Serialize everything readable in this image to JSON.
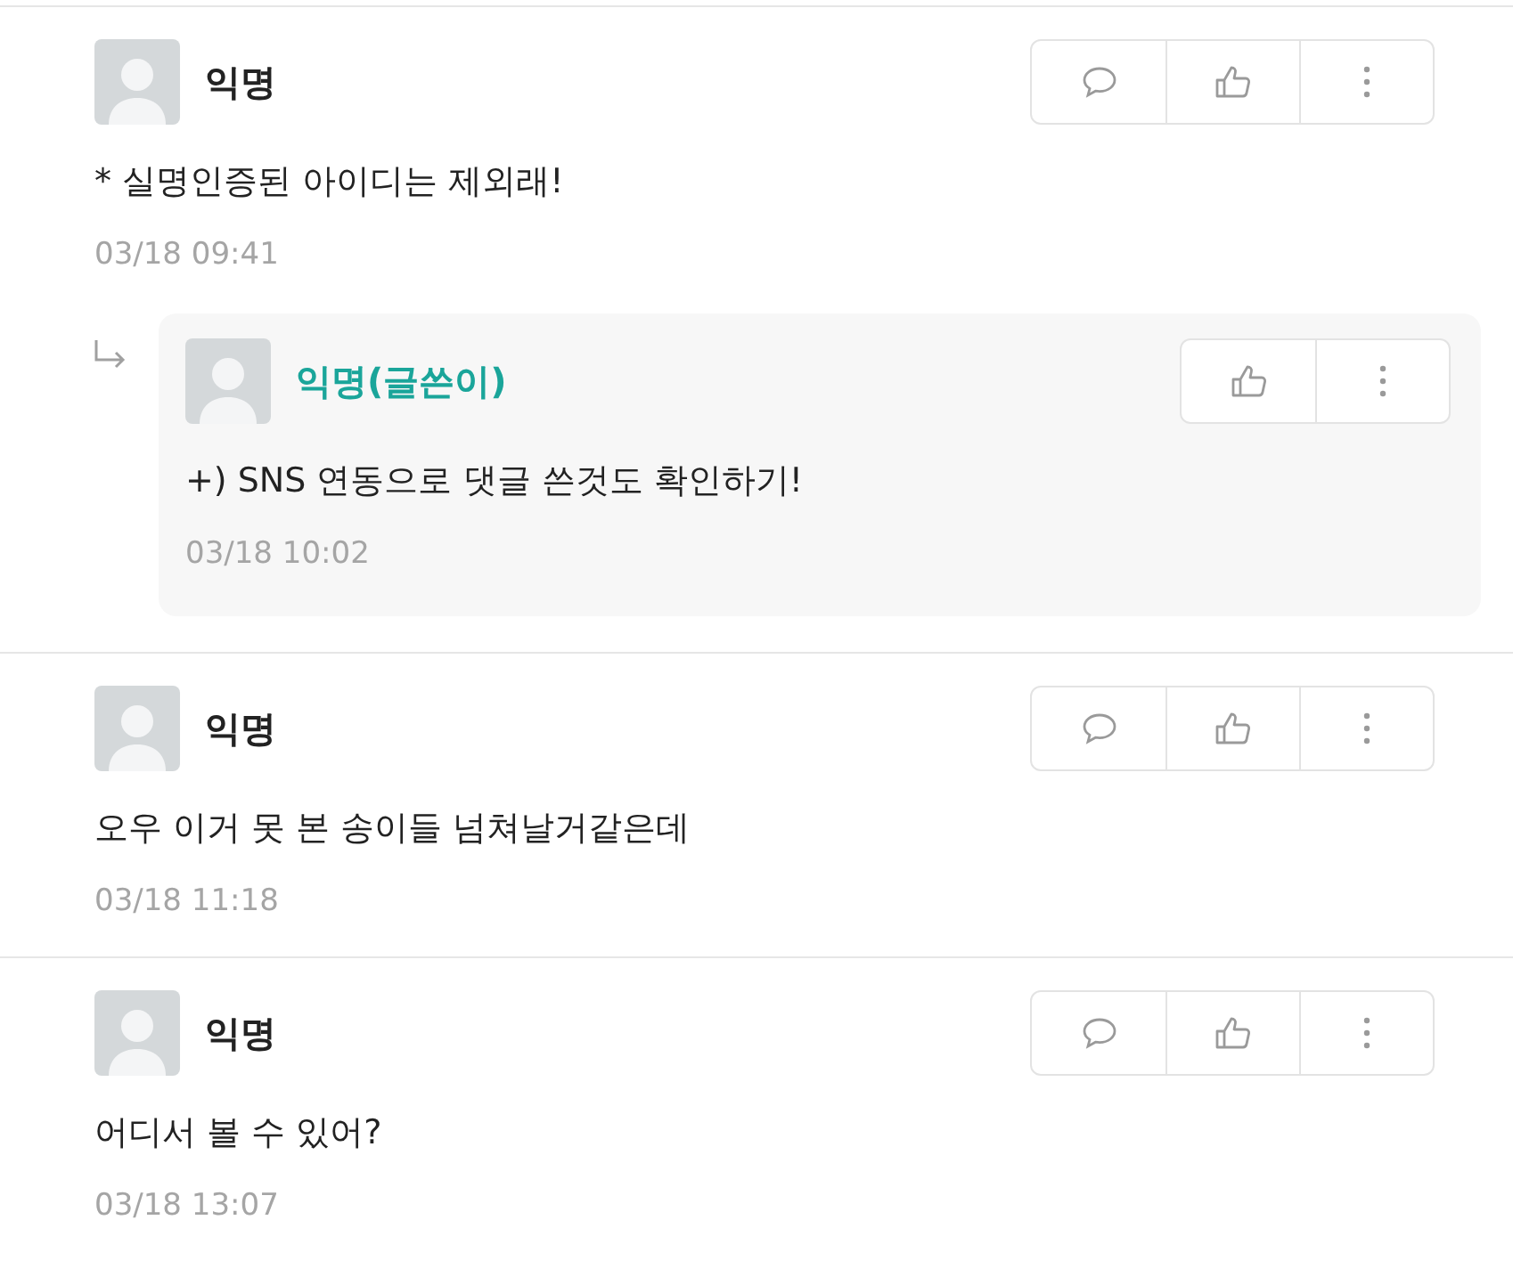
{
  "comments": [
    {
      "author": "익명",
      "is_author": false,
      "text": "* 실명인증된 아이디는 제외래!",
      "time": "03/18 09:41",
      "actions": [
        {
          "kind": "reply"
        },
        {
          "kind": "like"
        },
        {
          "kind": "more"
        }
      ],
      "children": [
        {
          "author": "익명(글쓴이)",
          "is_author": true,
          "text": "+) SNS 연동으로 댓글 쓴것도 확인하기!",
          "time": "03/18 10:02",
          "actions": [
            {
              "kind": "like"
            },
            {
              "kind": "more"
            }
          ]
        }
      ]
    },
    {
      "author": "익명",
      "is_author": false,
      "text": "오우 이거 못 본 송이들 넘쳐날거같은데",
      "time": "03/18 11:18",
      "actions": [
        {
          "kind": "reply"
        },
        {
          "kind": "like"
        },
        {
          "kind": "more"
        }
      ]
    },
    {
      "author": "익명",
      "is_author": false,
      "text": "어디서 볼 수 있어?",
      "time": "03/18 13:07",
      "actions": [
        {
          "kind": "reply"
        },
        {
          "kind": "like"
        },
        {
          "kind": "more"
        }
      ]
    }
  ]
}
